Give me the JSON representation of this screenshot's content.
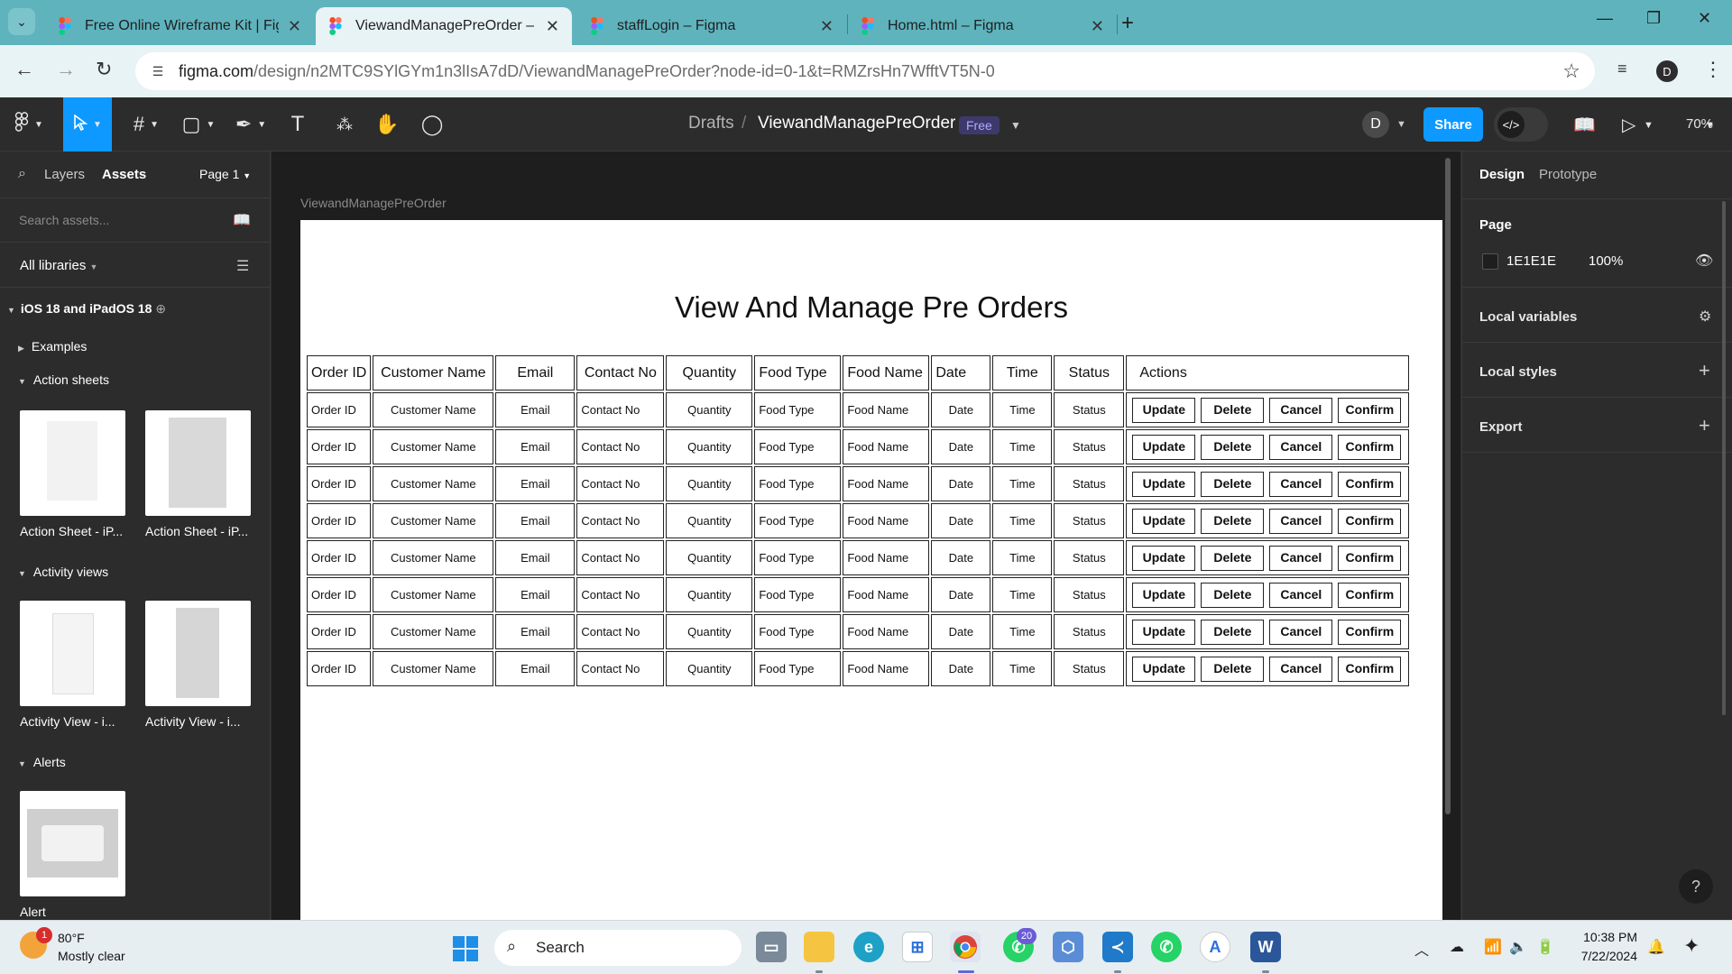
{
  "browser": {
    "tabs": [
      {
        "title": "Free Online Wireframe Kit | Figm",
        "active": false
      },
      {
        "title": "ViewandManagePreOrder – Figm",
        "active": true
      },
      {
        "title": "staffLogin – Figma",
        "active": false
      },
      {
        "title": "Home.html – Figma",
        "active": false
      }
    ],
    "url_host": "figma.com",
    "url_path": "/design/n2MTC9SYlGYm1n3lIsA7dD/ViewandManagePreOrder?node-id=0-1&t=RMZrsHn7WfftVT5N-0",
    "profile_initial": "D"
  },
  "figma": {
    "toolbar": {
      "breadcrumb_drafts": "Drafts",
      "breadcrumb_sep": "/",
      "file_name": "ViewandManagePreOrder",
      "plan_badge": "Free",
      "user_initial": "D",
      "share_label": "Share",
      "zoom_label": "70%"
    },
    "left_panel": {
      "tab_layers": "Layers",
      "tab_assets": "Assets",
      "page_selector": "Page 1",
      "search_placeholder": "Search assets...",
      "libraries_label": "All libraries",
      "library_title": "iOS 18 and iPadOS 18",
      "sections": {
        "examples": "Examples",
        "action_sheets": "Action sheets",
        "activity_views": "Activity views",
        "alerts": "Alerts"
      },
      "thumbs": {
        "action_sheet_1": "Action Sheet - iP...",
        "action_sheet_2": "Action Sheet - iP...",
        "activity_view_1": "Activity View - i...",
        "activity_view_2": "Activity View - i...",
        "alert": "Alert"
      }
    },
    "canvas": {
      "frame_label": "ViewandManagePreOrder",
      "heading": "View And Manage Pre Orders",
      "table_headers": [
        "Order ID",
        "Customer Name",
        "Email",
        "Contact No",
        "Quantity",
        "Food Type",
        "Food Name",
        "Date",
        "Time",
        "Status",
        "Actions"
      ],
      "row": [
        "Order ID",
        "Customer Name",
        "Email",
        "Contact No",
        "Quantity",
        "Food Type",
        "Food Name",
        "Date",
        "Time",
        "Status"
      ],
      "row_count": 8,
      "actions": [
        "Update",
        "Delete",
        "Cancel",
        "Confirm"
      ]
    },
    "right_panel": {
      "tab_design": "Design",
      "tab_prototype": "Prototype",
      "page_heading": "Page",
      "page_color": "1E1E1E",
      "page_opacity": "100%",
      "local_variables": "Local variables",
      "local_styles": "Local styles",
      "export": "Export"
    }
  },
  "taskbar": {
    "weather_temp": "80°F",
    "weather_desc": "Mostly clear",
    "weather_badge": "1",
    "search_label": "Search",
    "whatsapp_badge": "20",
    "time": "10:38 PM",
    "date": "7/22/2024"
  }
}
